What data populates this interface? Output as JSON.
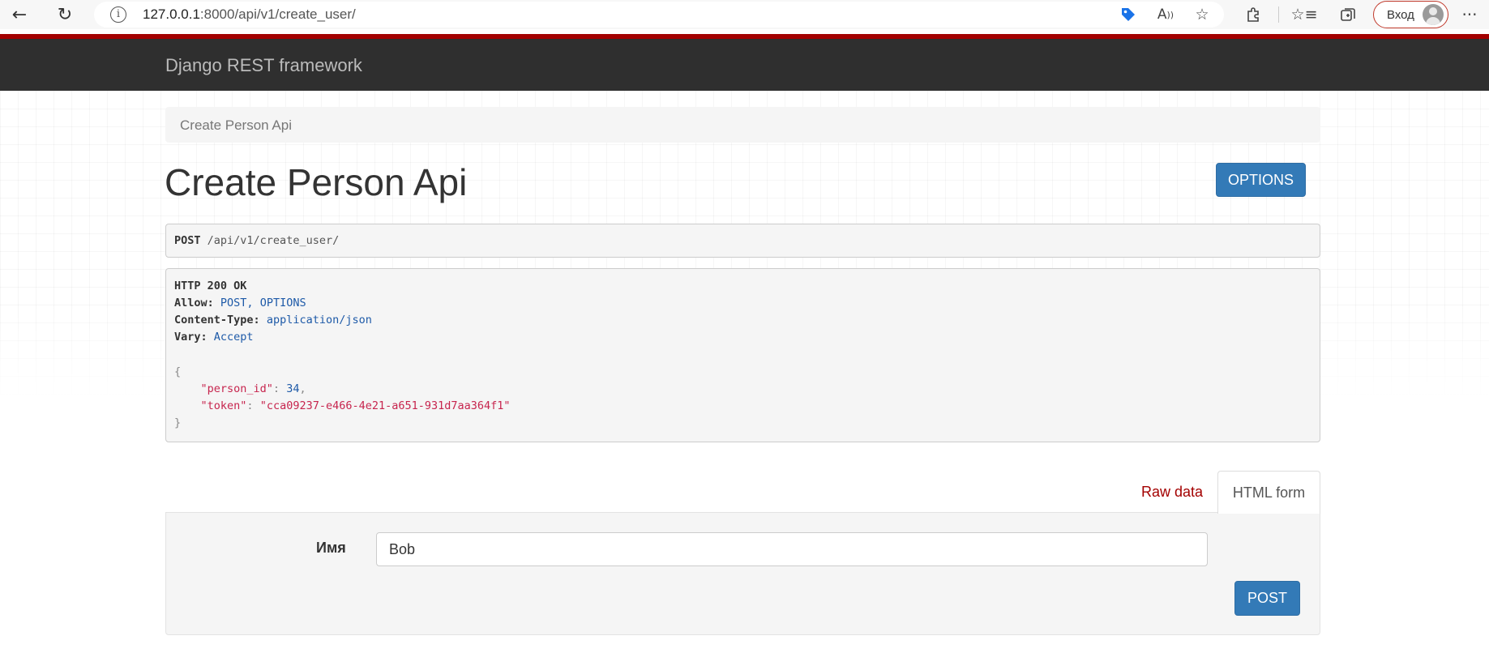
{
  "browser": {
    "url_host": "127.0.0.1",
    "url_rest": ":8000/api/v1/create_user/",
    "login_label": "Вход",
    "icons": [
      "back-icon",
      "reload-icon",
      "info-icon",
      "tag-icon",
      "read-aloud-icon",
      "add-favorite-icon",
      "extensions-icon",
      "favorites-icon",
      "collections-icon",
      "more-icon"
    ]
  },
  "navbar": {
    "brand": "Django REST framework"
  },
  "breadcrumb": {
    "items": [
      "Create Person Api"
    ]
  },
  "page": {
    "title": "Create Person Api",
    "options_label": "OPTIONS"
  },
  "request": {
    "method": "POST",
    "path": "/api/v1/create_user/"
  },
  "response": {
    "status": "HTTP 200 OK",
    "headers": [
      {
        "key": "Allow:",
        "value": "POST, OPTIONS"
      },
      {
        "key": "Content-Type:",
        "value": "application/json"
      },
      {
        "key": "Vary:",
        "value": "Accept"
      }
    ],
    "body": {
      "open": "{",
      "close": "}",
      "fields": [
        {
          "key": "\"person_id\"",
          "value": "34",
          "type": "number",
          "trailing": ","
        },
        {
          "key": "\"token\"",
          "value": "\"cca09237-e466-4e21-a651-931d7aa364f1\"",
          "type": "string",
          "trailing": ""
        }
      ]
    }
  },
  "form": {
    "tabs": [
      "Raw data",
      "HTML form"
    ],
    "active_tab": "HTML form",
    "field_label": "Имя",
    "field_value": "Bob",
    "submit_label": "POST"
  },
  "colors": {
    "accent": "#a30000",
    "button": "#337ab7",
    "navbar": "#2f2f2f"
  }
}
